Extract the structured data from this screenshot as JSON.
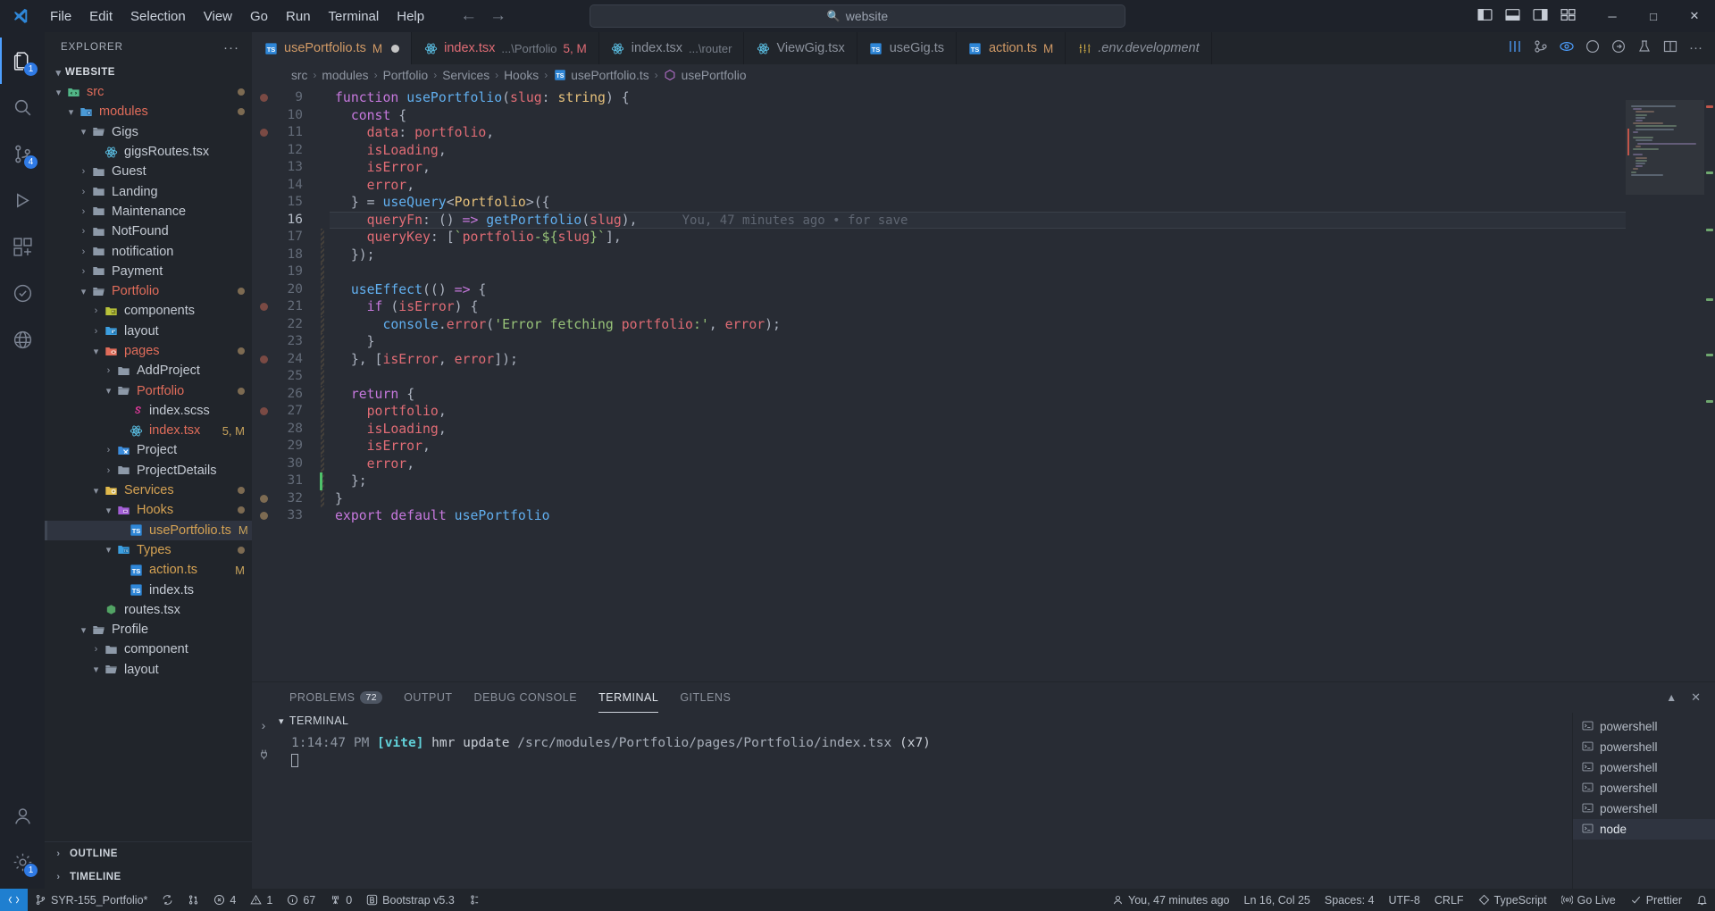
{
  "titlebar": {
    "menus": [
      "File",
      "Edit",
      "Selection",
      "View",
      "Go",
      "Run",
      "Terminal",
      "Help"
    ],
    "search_text": "website",
    "search_icon": "search-icon",
    "back_icon": "arrow-left-icon",
    "forward_icon": "arrow-right-icon",
    "minimize": "─",
    "maximize": "□",
    "close": "✕"
  },
  "activitybar": {
    "items": [
      {
        "name": "explorer",
        "badge": "1"
      },
      {
        "name": "search",
        "badge": ""
      },
      {
        "name": "source-control",
        "badge": "4"
      },
      {
        "name": "run-and-debug",
        "badge": ""
      },
      {
        "name": "extensions",
        "badge": ""
      },
      {
        "name": "testing",
        "badge": ""
      },
      {
        "name": "remote-explorer",
        "badge": ""
      }
    ],
    "bottom": [
      {
        "name": "accounts",
        "badge": ""
      },
      {
        "name": "settings",
        "badge": "1"
      }
    ]
  },
  "sidebar": {
    "title": "EXPLORER",
    "more_actions": "···",
    "root": "WEBSITE",
    "tree": [
      {
        "label": "src",
        "indent": 1,
        "chev": "down",
        "icon": "folder-src",
        "color": "orange",
        "mod": true
      },
      {
        "label": "modules",
        "indent": 2,
        "chev": "down",
        "icon": "folder-modules",
        "color": "orange",
        "mod": true
      },
      {
        "label": "Gigs",
        "indent": 3,
        "chev": "down",
        "icon": "folder-open",
        "color": "white",
        "mod": false
      },
      {
        "label": "gigsRoutes.tsx",
        "indent": 4,
        "chev": "none",
        "icon": "react",
        "color": "white",
        "mod": false
      },
      {
        "label": "Guest",
        "indent": 3,
        "chev": "right",
        "icon": "folder",
        "color": "white",
        "mod": false
      },
      {
        "label": "Landing",
        "indent": 3,
        "chev": "right",
        "icon": "folder",
        "color": "white",
        "mod": false
      },
      {
        "label": "Maintenance",
        "indent": 3,
        "chev": "right",
        "icon": "folder",
        "color": "white",
        "mod": false
      },
      {
        "label": "NotFound",
        "indent": 3,
        "chev": "right",
        "icon": "folder",
        "color": "white",
        "mod": false
      },
      {
        "label": "notification",
        "indent": 3,
        "chev": "right",
        "icon": "folder",
        "color": "white",
        "mod": false
      },
      {
        "label": "Payment",
        "indent": 3,
        "chev": "right",
        "icon": "folder",
        "color": "white",
        "mod": false
      },
      {
        "label": "Portfolio",
        "indent": 3,
        "chev": "down",
        "icon": "folder-open",
        "color": "orange",
        "mod": true
      },
      {
        "label": "components",
        "indent": 4,
        "chev": "right",
        "icon": "folder-components",
        "color": "white",
        "mod": false
      },
      {
        "label": "layout",
        "indent": 4,
        "chev": "right",
        "icon": "folder-layout",
        "color": "white",
        "mod": false
      },
      {
        "label": "pages",
        "indent": 4,
        "chev": "down",
        "icon": "folder-pages",
        "color": "orange",
        "mod": true
      },
      {
        "label": "AddProject",
        "indent": 5,
        "chev": "right",
        "icon": "folder",
        "color": "white",
        "mod": false
      },
      {
        "label": "Portfolio",
        "indent": 5,
        "chev": "down",
        "icon": "folder-open",
        "color": "orange",
        "mod": true
      },
      {
        "label": "index.scss",
        "indent": 6,
        "chev": "none",
        "icon": "sass",
        "color": "white",
        "mod": false
      },
      {
        "label": "index.tsx",
        "indent": 6,
        "chev": "none",
        "icon": "react",
        "color": "orange",
        "mod": false,
        "badge": "5, M"
      },
      {
        "label": "Project",
        "indent": 5,
        "chev": "right",
        "icon": "folder-tools",
        "color": "white",
        "mod": false
      },
      {
        "label": "ProjectDetails",
        "indent": 5,
        "chev": "right",
        "icon": "folder",
        "color": "white",
        "mod": false
      },
      {
        "label": "Services",
        "indent": 4,
        "chev": "down",
        "icon": "folder-services",
        "color": "yellow",
        "mod": true
      },
      {
        "label": "Hooks",
        "indent": 5,
        "chev": "down",
        "icon": "folder-hooks",
        "color": "yellow",
        "mod": true
      },
      {
        "label": "usePortfolio.ts",
        "indent": 6,
        "chev": "none",
        "icon": "ts",
        "color": "yellow",
        "selected": true,
        "badge": "M"
      },
      {
        "label": "Types",
        "indent": 5,
        "chev": "down",
        "icon": "folder-types",
        "color": "yellow",
        "mod": true
      },
      {
        "label": "action.ts",
        "indent": 6,
        "chev": "none",
        "icon": "ts",
        "color": "yellow",
        "badge": "M"
      },
      {
        "label": "index.ts",
        "indent": 6,
        "chev": "none",
        "icon": "ts",
        "color": "white",
        "mod": false
      },
      {
        "label": "routes.tsx",
        "indent": 4,
        "chev": "none",
        "icon": "routes",
        "color": "white",
        "mod": false
      },
      {
        "label": "Profile",
        "indent": 3,
        "chev": "down",
        "icon": "folder-open",
        "color": "white",
        "mod": false
      },
      {
        "label": "component",
        "indent": 4,
        "chev": "right",
        "icon": "folder",
        "color": "white",
        "mod": false
      },
      {
        "label": "layout",
        "indent": 4,
        "chev": "down",
        "icon": "folder-open",
        "color": "white",
        "mod": false
      }
    ],
    "footer": [
      {
        "label": "OUTLINE",
        "chev": "right"
      },
      {
        "label": "TIMELINE",
        "chev": "right"
      }
    ]
  },
  "tabs": [
    {
      "name": "usePortfolio.ts",
      "icon": "ts",
      "suffix": "M",
      "path": "",
      "active": true,
      "dirty": true,
      "nameclass": "mod"
    },
    {
      "name": "index.tsx",
      "icon": "react",
      "path": "...\\Portfolio",
      "suffix": "5, M",
      "active": false,
      "dirty": false,
      "nameclass": "err",
      "suffixclass": "err"
    },
    {
      "name": "index.tsx",
      "icon": "react",
      "path": "...\\router",
      "suffix": "",
      "active": false,
      "dirty": false,
      "nameclass": ""
    },
    {
      "name": "ViewGig.tsx",
      "icon": "react",
      "path": "",
      "suffix": "",
      "active": false,
      "dirty": false,
      "nameclass": ""
    },
    {
      "name": "useGig.ts",
      "icon": "ts",
      "path": "",
      "suffix": "",
      "active": false,
      "dirty": false,
      "nameclass": ""
    },
    {
      "name": "action.ts",
      "icon": "ts",
      "path": "",
      "suffix": "M",
      "active": false,
      "dirty": false,
      "nameclass": "mod"
    },
    {
      "name": ".env.development",
      "icon": "env",
      "path": "",
      "suffix": "",
      "active": false,
      "dirty": false,
      "nameclass": "italic"
    }
  ],
  "tab_actions": [
    "split-editor-icon",
    "more-actions-icon",
    "run-icon",
    "beaker-icon",
    "gitlens-icon"
  ],
  "breadcrumb": [
    "src",
    "modules",
    "Portfolio",
    "Services",
    "Hooks",
    "usePortfolio.ts",
    "usePortfolio"
  ],
  "editor": {
    "first_line": 9,
    "blame": "You, 47 minutes ago • for save",
    "lines": [
      {
        "n": 9,
        "text": "function usePortfolio(slug: string) {"
      },
      {
        "n": 10,
        "text": "  const {"
      },
      {
        "n": 11,
        "text": "    data: portfolio,"
      },
      {
        "n": 12,
        "text": "    isLoading,"
      },
      {
        "n": 13,
        "text": "    isError,"
      },
      {
        "n": 14,
        "text": "    error,"
      },
      {
        "n": 15,
        "text": "  } = useQuery<Portfolio>({"
      },
      {
        "n": 16,
        "text": "    queryFn: () => getPortfolio(slug),"
      },
      {
        "n": 17,
        "text": "    queryKey: [`portfolio-${slug}`],"
      },
      {
        "n": 18,
        "text": "  });"
      },
      {
        "n": 19,
        "text": ""
      },
      {
        "n": 20,
        "text": "  useEffect(() => {"
      },
      {
        "n": 21,
        "text": "    if (isError) {"
      },
      {
        "n": 22,
        "text": "      console.error('Error fetching portfolio:', error);"
      },
      {
        "n": 23,
        "text": "    }"
      },
      {
        "n": 24,
        "text": "  }, [isError, error]);"
      },
      {
        "n": 25,
        "text": ""
      },
      {
        "n": 26,
        "text": "  return {"
      },
      {
        "n": 27,
        "text": "    portfolio,"
      },
      {
        "n": 28,
        "text": "    isLoading,"
      },
      {
        "n": 29,
        "text": "    isError,"
      },
      {
        "n": 30,
        "text": "    error,"
      },
      {
        "n": 31,
        "text": "  };"
      },
      {
        "n": 32,
        "text": "}"
      },
      {
        "n": 33,
        "text": "export default usePortfolio"
      }
    ]
  },
  "panel": {
    "tabs": [
      {
        "label": "PROBLEMS",
        "count": "72",
        "active": false
      },
      {
        "label": "OUTPUT",
        "count": "",
        "active": false
      },
      {
        "label": "DEBUG CONSOLE",
        "count": "",
        "active": false
      },
      {
        "label": "TERMINAL",
        "count": "",
        "active": true
      },
      {
        "label": "GITLENS",
        "count": "",
        "active": false
      }
    ],
    "actions": [
      "chevron-up-icon",
      "close-icon"
    ],
    "terminal_title": "TERMINAL",
    "output": {
      "time": "1:14:47 PM",
      "tag": "[vite]",
      "message": "hmr update",
      "path": "/src/modules/Portfolio/pages/Portfolio/index.tsx",
      "count": "(x7)"
    },
    "terminal_list": [
      {
        "label": "powershell",
        "active": false
      },
      {
        "label": "powershell",
        "active": false
      },
      {
        "label": "powershell",
        "active": false
      },
      {
        "label": "powershell",
        "active": false
      },
      {
        "label": "powershell",
        "active": false
      },
      {
        "label": "node",
        "active": true
      }
    ]
  },
  "statusbar": {
    "left": [
      {
        "name": "remote-indicator",
        "icon": "remote-icon",
        "label": ""
      },
      {
        "name": "branch",
        "icon": "branch-icon",
        "label": "SYR-155_Portfolio*"
      },
      {
        "name": "sync",
        "icon": "sync-icon",
        "label": ""
      },
      {
        "name": "pull-request",
        "icon": "pr-icon",
        "label": ""
      },
      {
        "name": "problems",
        "icon": "error-icon",
        "label": "4"
      },
      {
        "name": "warnings",
        "icon": "warning-icon",
        "label": "1"
      },
      {
        "name": "info",
        "icon": "info-icon",
        "label": "67"
      },
      {
        "name": "ports",
        "icon": "radio-tower-icon",
        "label": "0"
      },
      {
        "name": "bootstrap",
        "icon": "bootstrap-icon",
        "label": "Bootstrap v5.3"
      },
      {
        "name": "gitlens-toggle",
        "icon": "gitlens-icon",
        "label": ""
      }
    ],
    "right": [
      {
        "name": "blame",
        "icon": "person-icon",
        "label": "You, 47 minutes ago"
      },
      {
        "name": "cursor-position",
        "icon": "",
        "label": "Ln 16, Col 25"
      },
      {
        "name": "indentation",
        "icon": "",
        "label": "Spaces: 4"
      },
      {
        "name": "encoding",
        "icon": "",
        "label": "UTF-8"
      },
      {
        "name": "eol",
        "icon": "",
        "label": "CRLF"
      },
      {
        "name": "language-mode",
        "icon": "ts-icon",
        "label": "TypeScript"
      },
      {
        "name": "go-live",
        "icon": "broadcast-icon",
        "label": "Go Live"
      },
      {
        "name": "prettier",
        "icon": "check-icon",
        "label": "Prettier"
      },
      {
        "name": "notifications",
        "icon": "bell-icon",
        "label": ""
      }
    ]
  }
}
